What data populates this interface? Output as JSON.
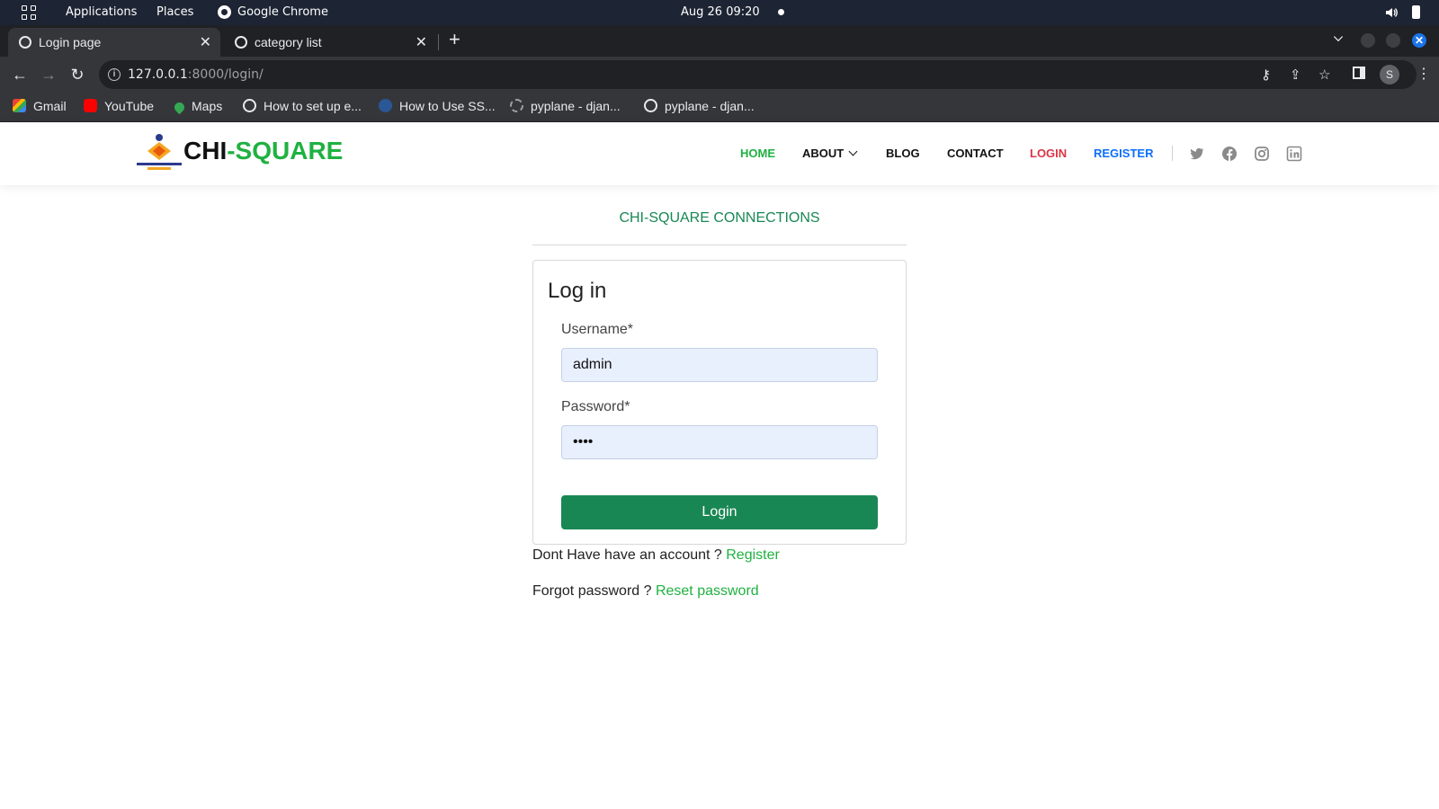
{
  "os_topbar": {
    "applications": "Applications",
    "places": "Places",
    "active_app": "Google Chrome",
    "clock": "Aug 26  09:20"
  },
  "browser": {
    "tabs": [
      {
        "title": "Login page",
        "active": true
      },
      {
        "title": "category list",
        "active": false
      }
    ],
    "url_host": "127.0.0.1",
    "url_rest": ":8000/login/",
    "profile_initial": "S",
    "bookmarks": [
      {
        "label": "Gmail",
        "icon": "gmail-icon"
      },
      {
        "label": "YouTube",
        "icon": "youtube-icon"
      },
      {
        "label": "Maps",
        "icon": "maps-icon"
      },
      {
        "label": "How to set up e...",
        "icon": "globe-icon"
      },
      {
        "label": "How to Use SS...",
        "icon": "ssh-site-icon"
      },
      {
        "label": "pyplane - djan...",
        "icon": "loading-icon"
      },
      {
        "label": "pyplane - djan...",
        "icon": "globe-icon"
      }
    ]
  },
  "site": {
    "logo_part1": "CHI",
    "logo_part2": "-SQUARE",
    "nav": {
      "home": "HOME",
      "about": "ABOUT",
      "blog": "BLOG",
      "contact": "CONTACT",
      "login": "LOGIN",
      "register": "REGISTER"
    },
    "social_icons": [
      "twitter-icon",
      "facebook-icon",
      "instagram-icon",
      "linkedin-icon"
    ],
    "colors": {
      "brand_green": "#1fb141",
      "button_green": "#198754",
      "login_red": "#dc3545",
      "register_blue": "#0d6efd"
    }
  },
  "login": {
    "brand_title": "CHI-SQUARE CONNECTIONS",
    "card_title": "Log in",
    "username_label": "Username*",
    "username_value": "admin",
    "password_label": "Password*",
    "password_value": "••••",
    "submit_label": "Login",
    "no_account_text": "Dont Have have an account ? ",
    "register_link": "Register",
    "forgot_text": "Forgot password ? ",
    "reset_link": "Reset password"
  }
}
